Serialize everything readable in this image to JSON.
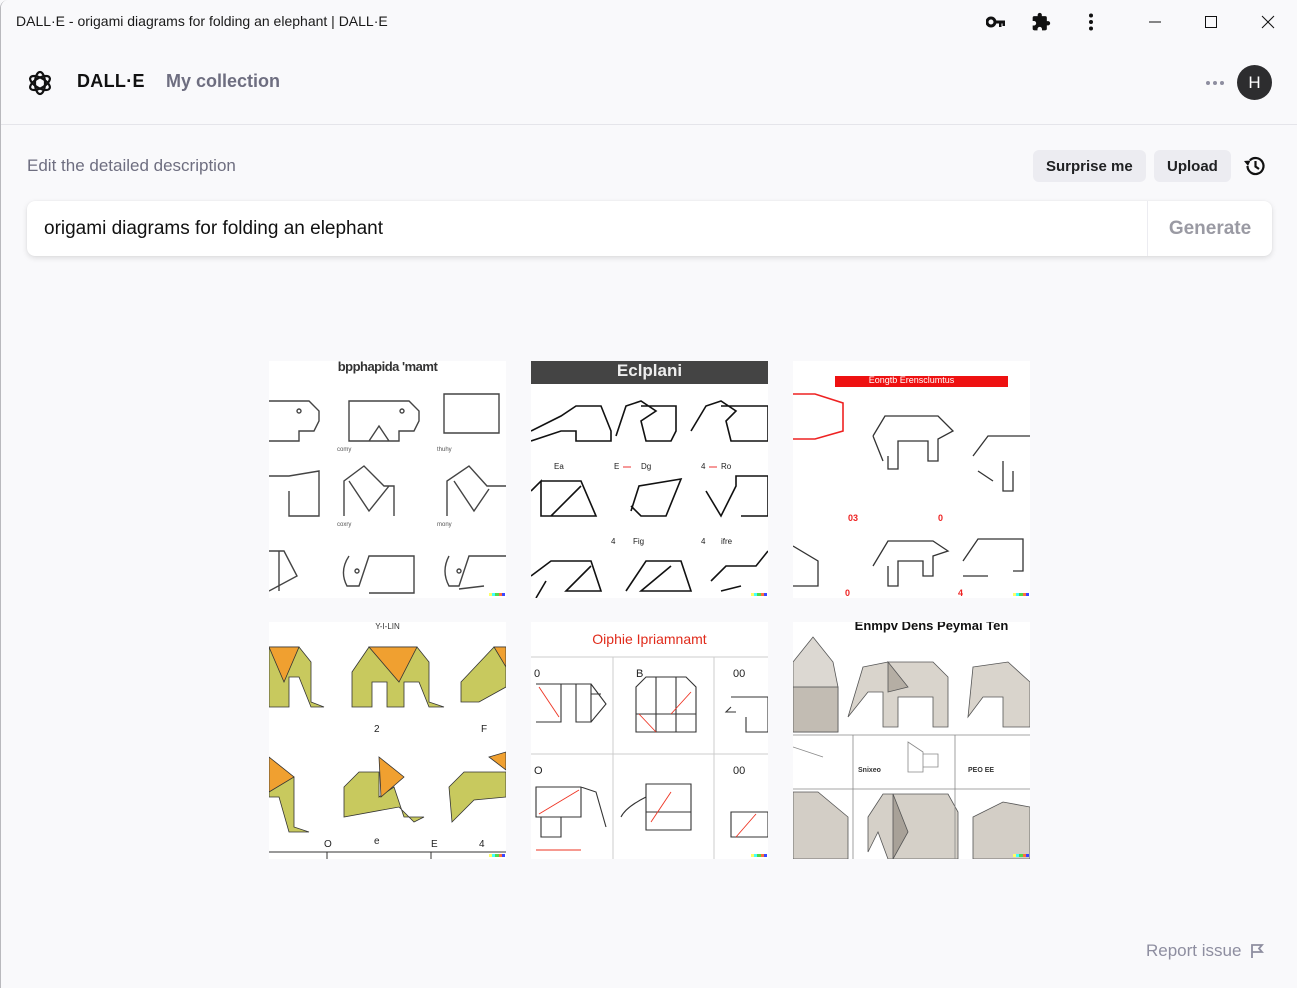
{
  "window": {
    "title": "DALL·E - origami diagrams for folding an elephant | DALL·E",
    "controls": {
      "key_icon": "key-icon",
      "extensions_icon": "puzzle-icon",
      "menu_icon": "kebab-icon",
      "minimize_icon": "minimize-icon",
      "maximize_icon": "maximize-icon",
      "close_icon": "close-icon"
    }
  },
  "header": {
    "brand": "DALL·E",
    "nav": [
      {
        "label": "My collection"
      }
    ],
    "avatar_initial": "H",
    "more_icon": "more-horizontal-icon"
  },
  "prompt": {
    "label": "Edit the detailed description",
    "surprise_label": "Surprise me",
    "upload_label": "Upload",
    "history_icon": "history-icon",
    "value": "origami diagrams for folding an elephant",
    "generate_label": "Generate"
  },
  "results": [
    {
      "caption": "bpphapida 'mamt",
      "style": "line-drawing"
    },
    {
      "caption": "Eclplani",
      "style": "banner-line-drawing",
      "labels": [
        "Ea",
        "E — Dg",
        "4 — Ro",
        "4 — Fig",
        "4 — ifre"
      ]
    },
    {
      "caption": "Eongtb Erensclumtus",
      "style": "red-banner-line-drawing",
      "labels": [
        "03",
        "0",
        "0",
        "4"
      ]
    },
    {
      "caption": "Y-I-LIN",
      "style": "colored-origami",
      "labels": [
        "2",
        "F",
        "O",
        "e",
        "E",
        "4"
      ]
    },
    {
      "caption": "Oiphie Ipriamnamt",
      "style": "step-grid",
      "labels": [
        "0",
        "B",
        "00",
        "O",
        "00"
      ]
    },
    {
      "caption": "Enmpv Dens Peymai Ten",
      "style": "grey-origami",
      "labels": [
        "Snixeo",
        "PEO EE"
      ]
    }
  ],
  "watermark_colors": [
    "#ffff66",
    "#42ffff",
    "#51da4c",
    "#ff6e3c",
    "#3c46ff"
  ],
  "footer": {
    "report_label": "Report issue",
    "report_icon": "flag-icon"
  }
}
